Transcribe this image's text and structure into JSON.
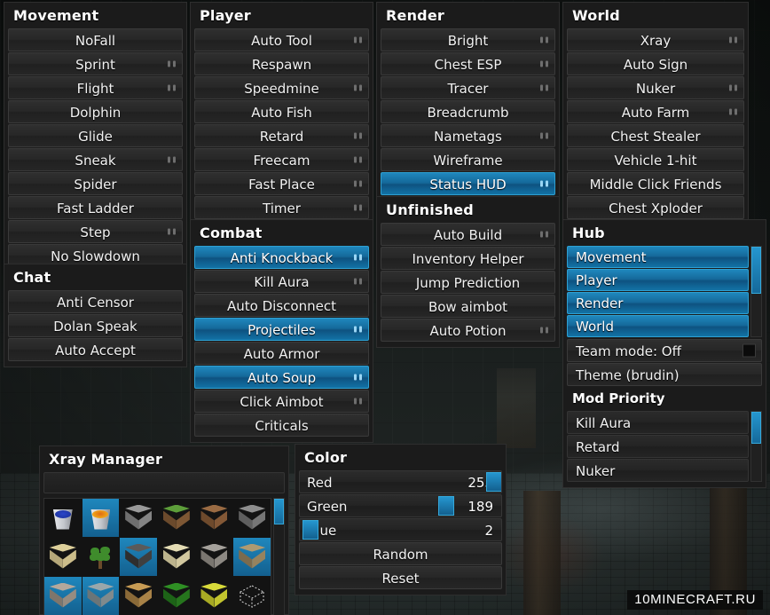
{
  "theme": {
    "accent": "#1f87bd",
    "accent_dark": "#0e5280",
    "panel_bg": "#1b1b1b",
    "button_bg": "#272727",
    "text": "#f2f2f2"
  },
  "panels": {
    "movement": {
      "title": "Movement",
      "items": [
        {
          "label": "NoFall",
          "on": false,
          "settings": false
        },
        {
          "label": "Sprint",
          "on": false,
          "settings": true
        },
        {
          "label": "Flight",
          "on": false,
          "settings": true
        },
        {
          "label": "Dolphin",
          "on": false,
          "settings": false
        },
        {
          "label": "Glide",
          "on": false,
          "settings": false
        },
        {
          "label": "Sneak",
          "on": false,
          "settings": true
        },
        {
          "label": "Spider",
          "on": false,
          "settings": false
        },
        {
          "label": "Fast Ladder",
          "on": false,
          "settings": false
        },
        {
          "label": "Step",
          "on": false,
          "settings": true
        },
        {
          "label": "No Slowdown",
          "on": false,
          "settings": false
        }
      ]
    },
    "chat": {
      "title": "Chat",
      "items": [
        {
          "label": "Anti Censor",
          "on": false,
          "settings": false
        },
        {
          "label": "Dolan Speak",
          "on": false,
          "settings": false
        },
        {
          "label": "Auto Accept",
          "on": false,
          "settings": false
        }
      ]
    },
    "player": {
      "title": "Player",
      "items": [
        {
          "label": "Auto Tool",
          "on": false,
          "settings": true
        },
        {
          "label": "Respawn",
          "on": false,
          "settings": false
        },
        {
          "label": "Speedmine",
          "on": false,
          "settings": true
        },
        {
          "label": "Auto Fish",
          "on": false,
          "settings": false
        },
        {
          "label": "Retard",
          "on": false,
          "settings": true
        },
        {
          "label": "Freecam",
          "on": false,
          "settings": true
        },
        {
          "label": "Fast Place",
          "on": false,
          "settings": true
        },
        {
          "label": "Timer",
          "on": false,
          "settings": true
        }
      ]
    },
    "combat": {
      "title": "Combat",
      "items": [
        {
          "label": "Anti Knockback",
          "on": true,
          "settings": true
        },
        {
          "label": "Kill Aura",
          "on": false,
          "settings": true
        },
        {
          "label": "Auto Disconnect",
          "on": false,
          "settings": false
        },
        {
          "label": "Projectiles",
          "on": true,
          "settings": true
        },
        {
          "label": "Auto Armor",
          "on": false,
          "settings": false
        },
        {
          "label": "Auto Soup",
          "on": true,
          "settings": true
        },
        {
          "label": "Click Aimbot",
          "on": false,
          "settings": true
        },
        {
          "label": "Criticals",
          "on": false,
          "settings": false
        }
      ]
    },
    "render": {
      "title": "Render",
      "items": [
        {
          "label": "Bright",
          "on": false,
          "settings": true
        },
        {
          "label": "Chest ESP",
          "on": false,
          "settings": true
        },
        {
          "label": "Tracer",
          "on": false,
          "settings": true
        },
        {
          "label": "Breadcrumb",
          "on": false,
          "settings": false
        },
        {
          "label": "Nametags",
          "on": false,
          "settings": true
        },
        {
          "label": "Wireframe",
          "on": false,
          "settings": false
        },
        {
          "label": "Status HUD",
          "on": true,
          "settings": true
        }
      ]
    },
    "unfinished": {
      "title": "Unfinished",
      "items": [
        {
          "label": "Auto Build",
          "on": false,
          "settings": true
        },
        {
          "label": "Inventory Helper",
          "on": false,
          "settings": false
        },
        {
          "label": "Jump Prediction",
          "on": false,
          "settings": false
        },
        {
          "label": "Bow aimbot",
          "on": false,
          "settings": false
        },
        {
          "label": "Auto Potion",
          "on": false,
          "settings": true
        }
      ]
    },
    "world": {
      "title": "World",
      "items": [
        {
          "label": "Xray",
          "on": false,
          "settings": true
        },
        {
          "label": "Auto Sign",
          "on": false,
          "settings": false
        },
        {
          "label": "Nuker",
          "on": false,
          "settings": true
        },
        {
          "label": "Auto Farm",
          "on": false,
          "settings": true
        },
        {
          "label": "Chest Stealer",
          "on": false,
          "settings": false
        },
        {
          "label": "Vehicle 1-hit",
          "on": false,
          "settings": false
        },
        {
          "label": "Middle Click Friends",
          "on": false,
          "settings": false
        },
        {
          "label": "Chest Xploder",
          "on": false,
          "settings": false
        }
      ]
    },
    "hub": {
      "title": "Hub",
      "categories": [
        {
          "label": "Movement"
        },
        {
          "label": "Player"
        },
        {
          "label": "Render"
        },
        {
          "label": "World"
        }
      ],
      "team_mode": {
        "label": "Team mode: Off",
        "enabled": false
      },
      "theme": {
        "label": "Theme (brudin)"
      },
      "mod_priority": {
        "title": "Mod Priority",
        "items": [
          {
            "label": "Kill Aura"
          },
          {
            "label": "Retard"
          },
          {
            "label": "Nuker"
          }
        ]
      }
    },
    "xray_manager": {
      "title": "Xray Manager",
      "search_value": "",
      "search_placeholder": "",
      "blocks": [
        {
          "name": "water-bucket",
          "selected": false
        },
        {
          "name": "lava-bucket",
          "selected": true
        },
        {
          "name": "stone-block",
          "selected": false
        },
        {
          "name": "grass-block",
          "selected": false
        },
        {
          "name": "dirt-block",
          "selected": false
        },
        {
          "name": "cobblestone-block",
          "selected": false
        },
        {
          "name": "sandstone-block",
          "selected": false
        },
        {
          "name": "sapling-block",
          "selected": false
        },
        {
          "name": "coal-ore-block",
          "selected": true
        },
        {
          "name": "sand-block",
          "selected": false
        },
        {
          "name": "gravel-block",
          "selected": false
        },
        {
          "name": "gold-ore-block",
          "selected": true
        },
        {
          "name": "iron-ore-block",
          "selected": true
        },
        {
          "name": "diamond-ore-block",
          "selected": true
        },
        {
          "name": "wood-planks-block",
          "selected": false
        },
        {
          "name": "leaves-block",
          "selected": false
        },
        {
          "name": "sponge-block",
          "selected": false
        },
        {
          "name": "glass-block",
          "selected": false
        }
      ]
    },
    "color": {
      "title": "Color",
      "sliders": [
        {
          "label": "Red",
          "value": "255",
          "percent": 100
        },
        {
          "label": "Green",
          "value": "189",
          "percent": 74
        },
        {
          "label": "Blue",
          "value": "2",
          "percent": 1
        }
      ],
      "buttons": [
        {
          "label": "Random"
        },
        {
          "label": "Reset"
        }
      ]
    }
  },
  "watermark": {
    "text": "10MINECRAFT.RU"
  }
}
